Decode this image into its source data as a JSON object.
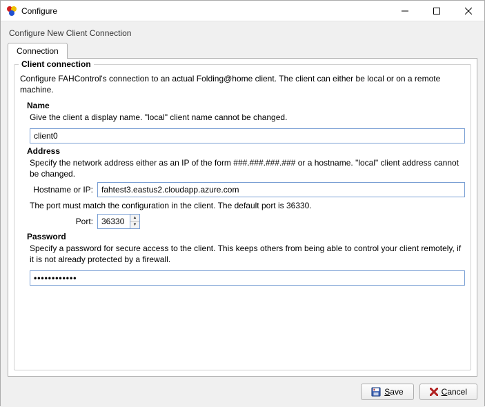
{
  "window": {
    "title": "Configure",
    "subtitle": "Configure New Client Connection"
  },
  "tabs": {
    "connection": "Connection"
  },
  "group": {
    "legend": "Client connection",
    "desc": "Configure FAHControl's connection to an actual Folding@home client.  The client can either be local or on a remote machine."
  },
  "name": {
    "title": "Name",
    "desc": "Give the client a display name.  \"local\" client name cannot be changed.",
    "value": "client0"
  },
  "address": {
    "title": "Address",
    "desc": "Specify the network address either as an IP of the form ###.###.###.### or a hostname.  \"local\" client address cannot be changed.",
    "host_label": "Hostname or IP:",
    "host_value": "fahtest3.eastus2.cloudapp.azure.com",
    "port_desc": "The port must match the configuration in the client.  The default port is 36330.",
    "port_label": "Port:",
    "port_value": "36330"
  },
  "password": {
    "title": "Password",
    "desc": "Specify a password for secure access to the client.  This keeps others from being able to control your client remotely, if it is not already protected by a firewall.",
    "value": "••••••••••••"
  },
  "buttons": {
    "save": "Save",
    "cancel": "Cancel"
  }
}
